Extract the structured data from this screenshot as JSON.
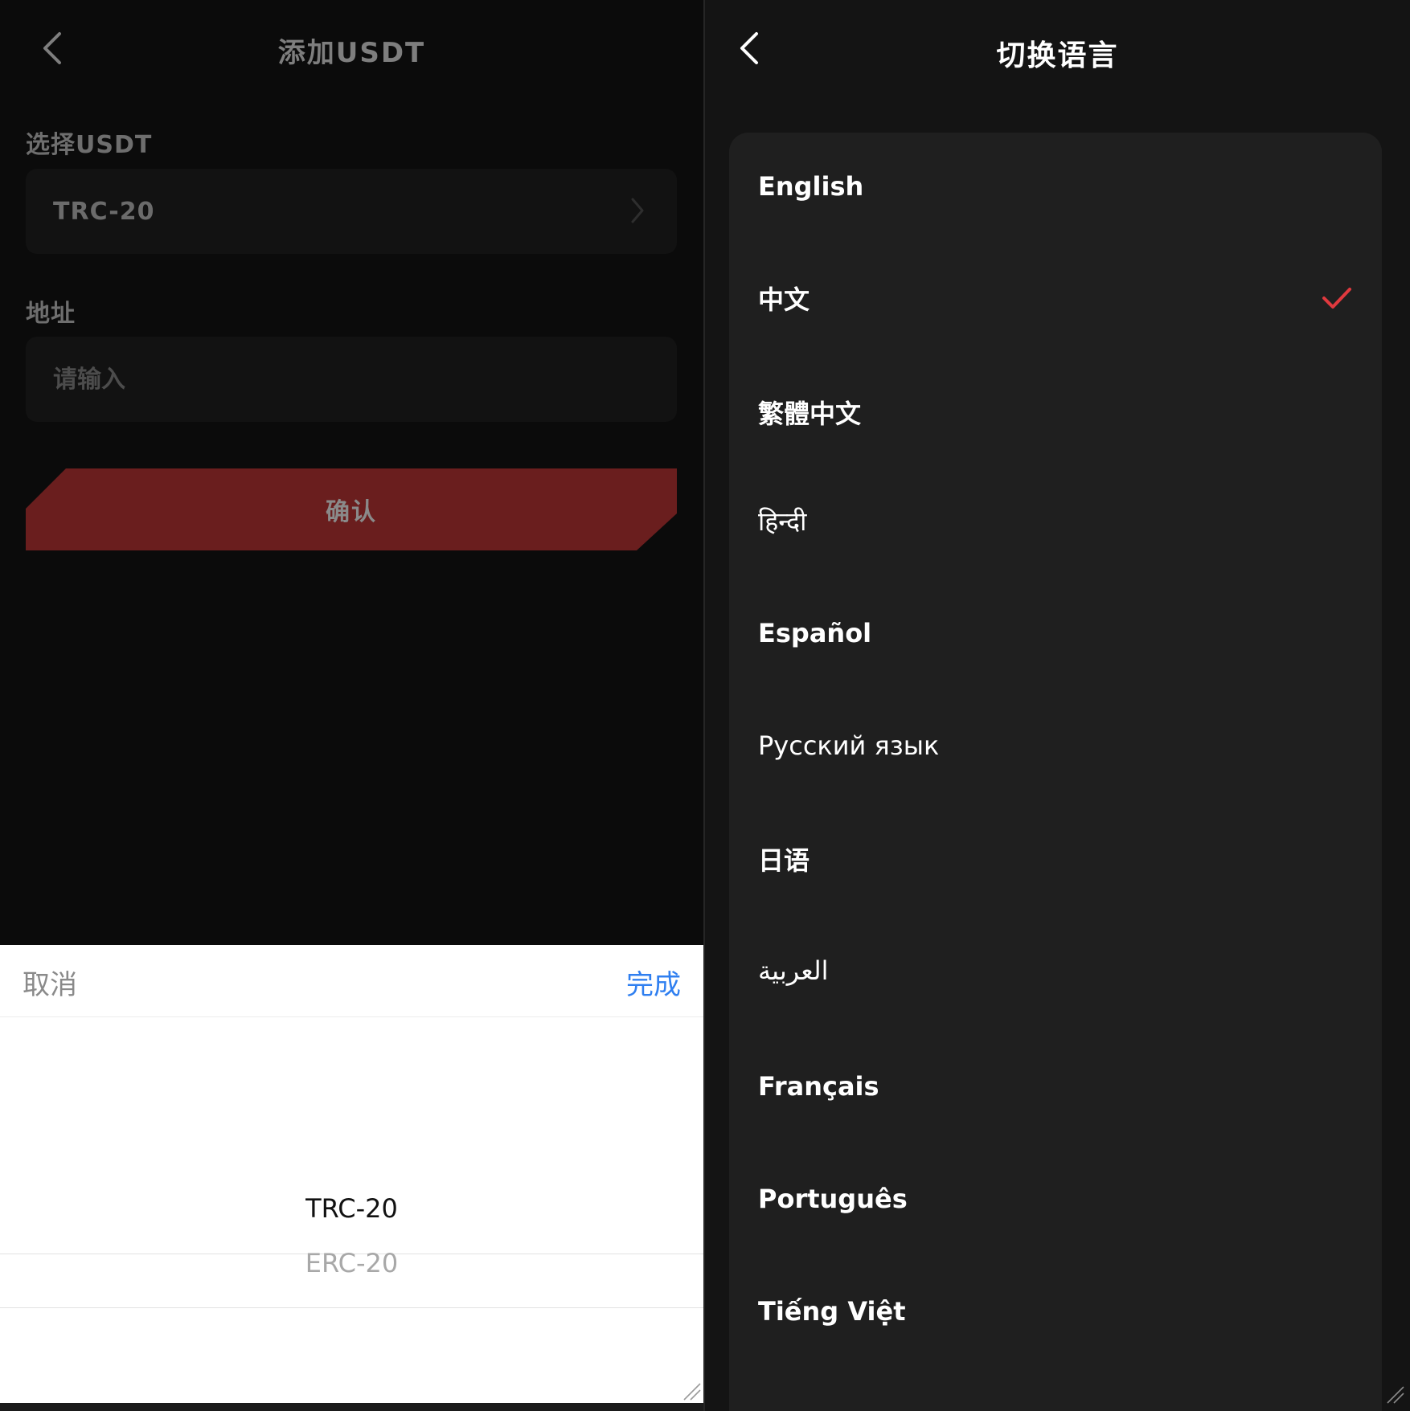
{
  "add_usdt": {
    "title": "添加USDT",
    "select_label": "选择USDT",
    "selected_network": "TRC-20",
    "address_label": "地址",
    "address_placeholder": "请输入",
    "address_value": "",
    "confirm_label": "确认"
  },
  "picker": {
    "cancel_label": "取消",
    "done_label": "完成",
    "options": [
      "TRC-20",
      "ERC-20"
    ],
    "selected_index": 0
  },
  "language": {
    "title": "切换语言",
    "items": [
      {
        "label": "English"
      },
      {
        "label": "中文"
      },
      {
        "label": "繁體中文"
      },
      {
        "label": "हिन्दी"
      },
      {
        "label": "Español"
      },
      {
        "label": "Русский язык"
      },
      {
        "label": "日语"
      },
      {
        "label": "العربية"
      },
      {
        "label": "Français"
      },
      {
        "label": "Português"
      },
      {
        "label": "Tiếng Việt"
      }
    ],
    "selected_index": 1
  },
  "colors": {
    "accent_red": "#6a1e1e",
    "check_red": "#e0393e",
    "done_blue": "#2f7ff0"
  },
  "icons": {
    "back": "chevron-left-icon",
    "field_arrow": "chevron-right-icon",
    "selected": "checkmark-icon",
    "resize": "resize-grip-icon"
  }
}
